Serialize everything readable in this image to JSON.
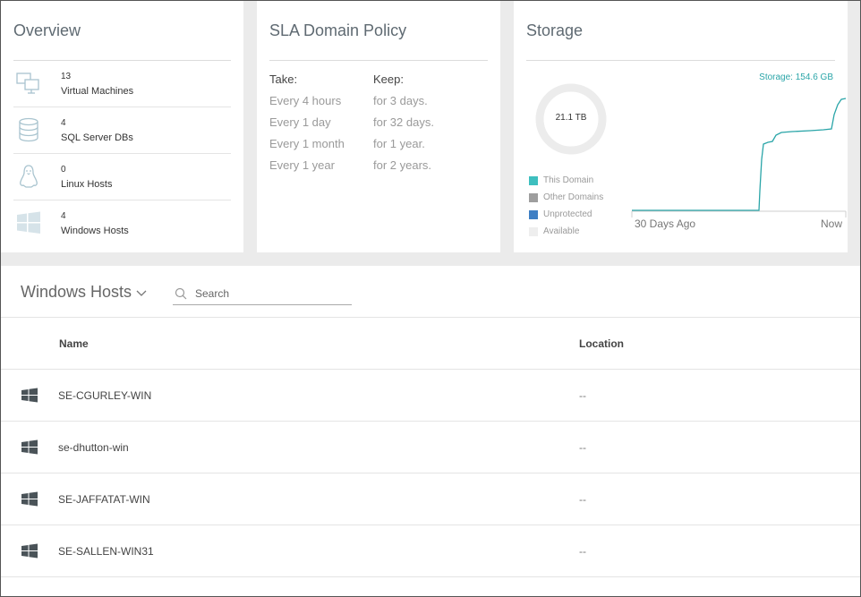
{
  "overview": {
    "title": "Overview",
    "items": [
      {
        "count": "13",
        "label": "Virtual Machines",
        "icon": "monitors-icon"
      },
      {
        "count": "4",
        "label": "SQL Server DBs",
        "icon": "database-icon"
      },
      {
        "count": "0",
        "label": "Linux Hosts",
        "icon": "linux-penguin-icon"
      },
      {
        "count": "4",
        "label": "Windows Hosts",
        "icon": "windows-icon"
      }
    ]
  },
  "sla": {
    "title": "SLA Domain Policy",
    "take_header": "Take:",
    "keep_header": "Keep:",
    "take": [
      "Every 4 hours",
      "Every 1 day",
      "Every 1 month",
      "Every 1 year"
    ],
    "keep": [
      "for 3 days.",
      "for 32 days.",
      "for 1 year.",
      "for 2 years."
    ]
  },
  "storage": {
    "title": "Storage",
    "total": "21.1 TB",
    "storage_label": "Storage: 154.6 GB",
    "legend": [
      {
        "label": "This Domain",
        "color": "#3ebfbf"
      },
      {
        "label": "Other Domains",
        "color": "#9e9e9e"
      },
      {
        "label": "Unprotected",
        "color": "#3f7fc4"
      },
      {
        "label": "Available",
        "color": "#eeeeee"
      }
    ],
    "x_start_label": "30 Days Ago",
    "x_end_label": "Now",
    "line_color": "#2aa5a8"
  },
  "list": {
    "title": "Windows Hosts",
    "search_placeholder": "Search",
    "columns": {
      "name": "Name",
      "location": "Location"
    },
    "rows": [
      {
        "name": "SE-CGURLEY-WIN",
        "location": "--"
      },
      {
        "name": "se-dhutton-win",
        "location": "--"
      },
      {
        "name": "SE-JAFFATAT-WIN",
        "location": "--"
      },
      {
        "name": "SE-SALLEN-WIN31",
        "location": "--"
      }
    ]
  }
}
